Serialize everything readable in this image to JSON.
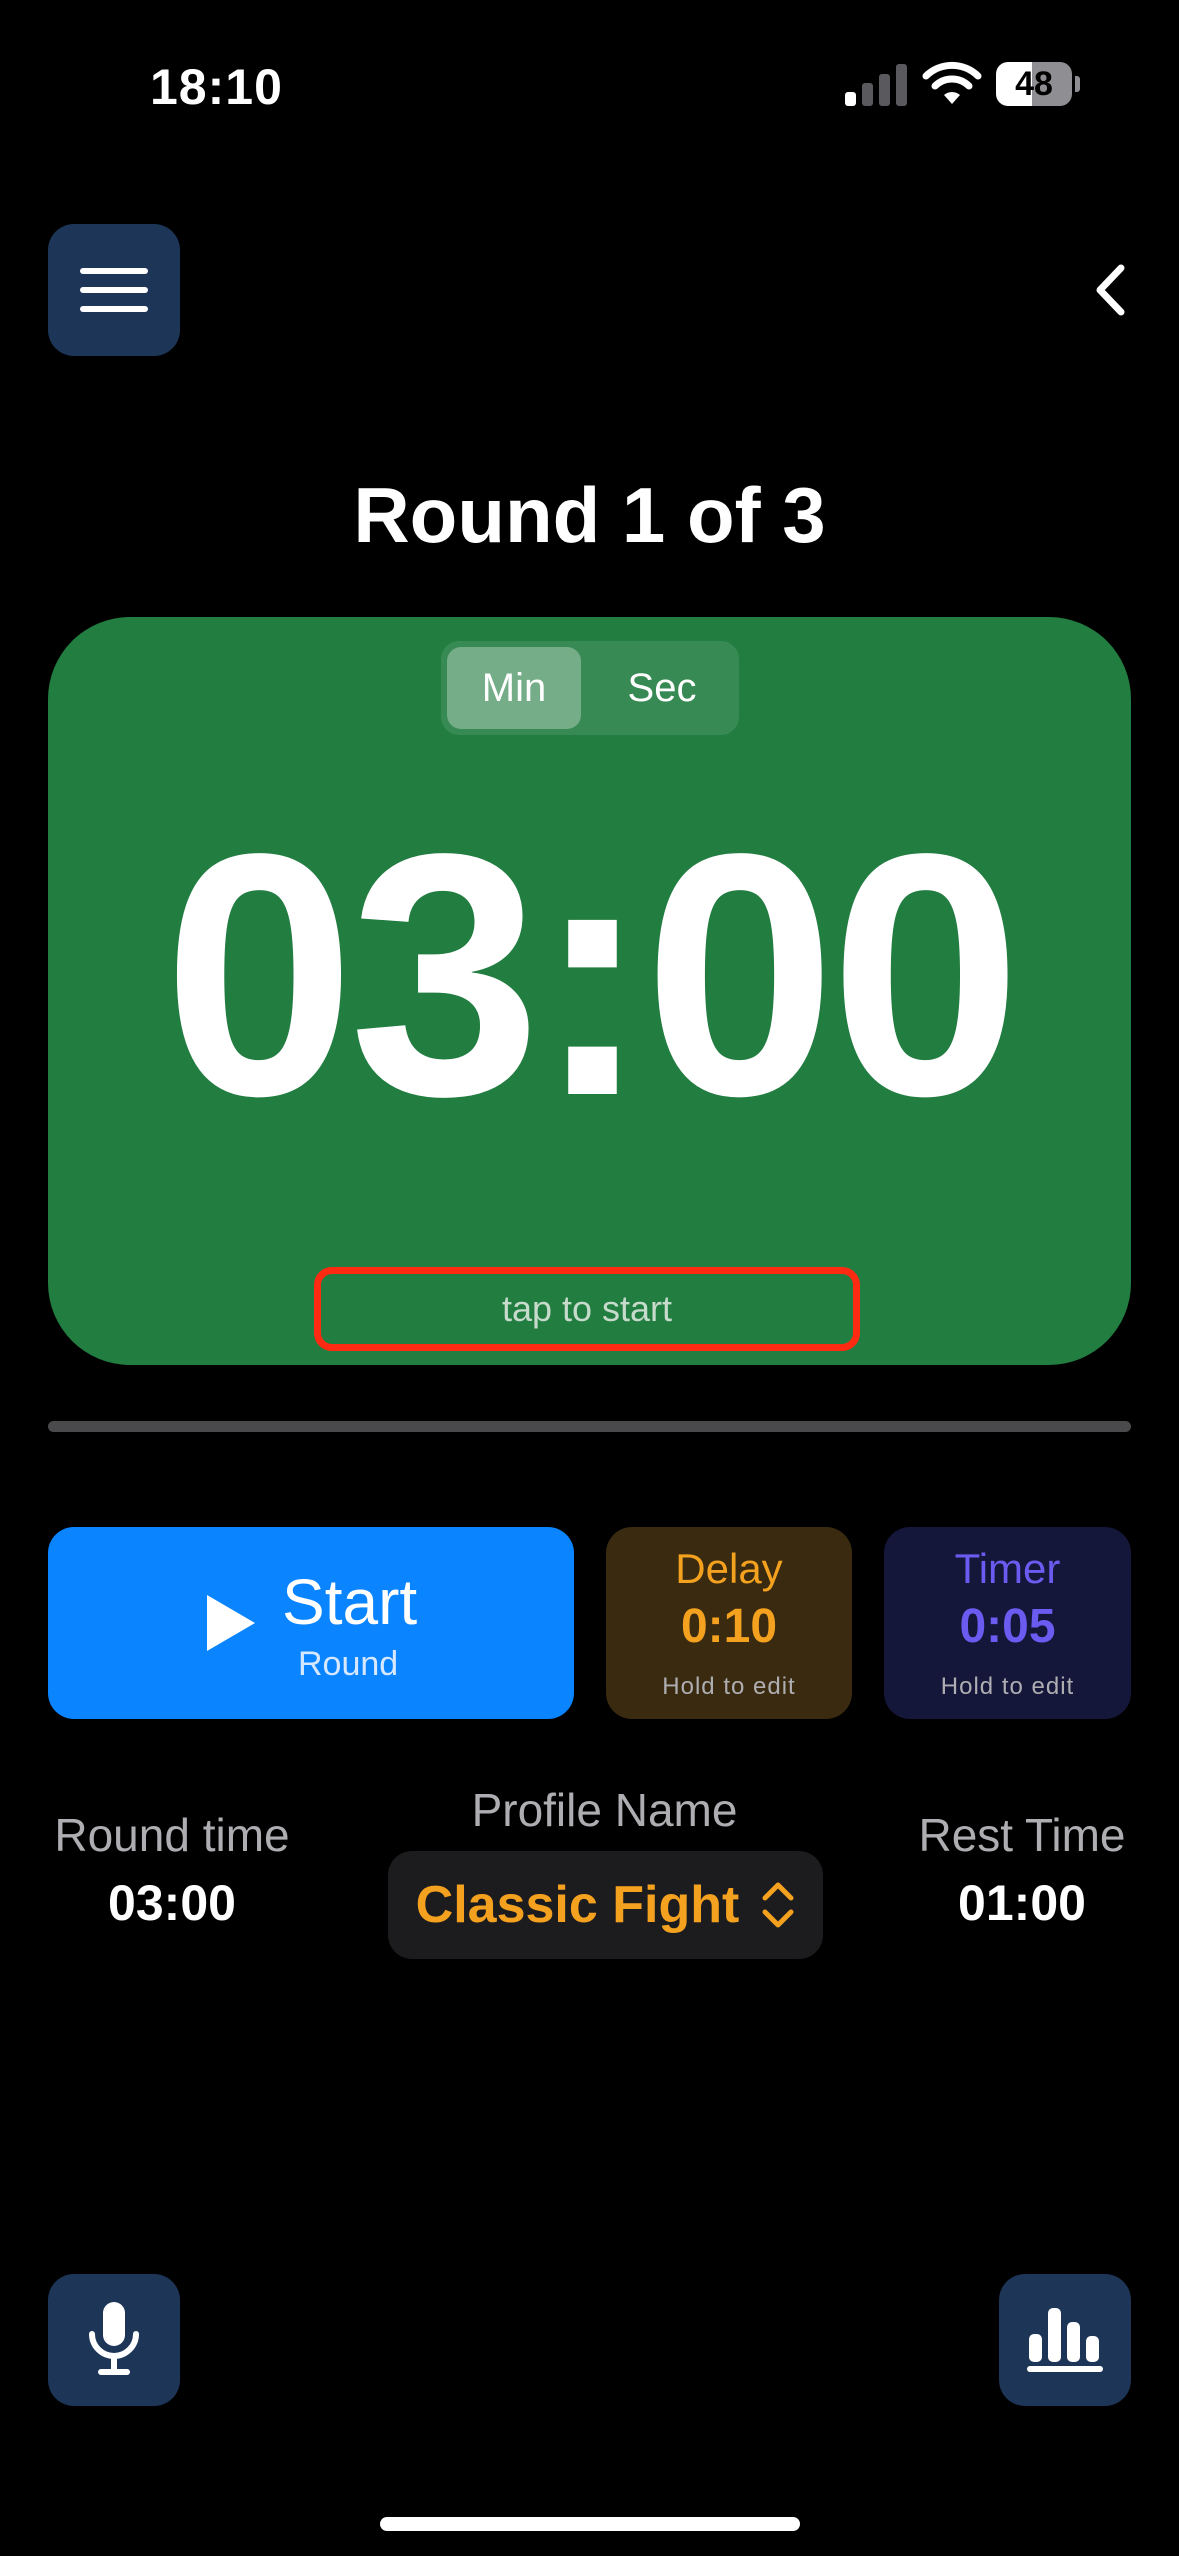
{
  "status_bar": {
    "time": "18:10",
    "battery_level": "48",
    "battery_fraction": 0.48
  },
  "header": {
    "menu_icon": "hamburger-icon",
    "back_icon": "chevron-left-icon",
    "round_title": "Round 1 of 3"
  },
  "timer": {
    "unit_options": [
      "Min",
      "Sec"
    ],
    "selected_unit": "Min",
    "display": "03:00",
    "hint": "tap to start",
    "background_color": "#227d41",
    "hint_highlight_color": "#ff2a12",
    "progress_fraction": 0
  },
  "actions": {
    "start": {
      "label": "Start",
      "sublabel": "Round",
      "icon": "play-icon",
      "color": "#0a84ff"
    },
    "delay": {
      "title": "Delay",
      "value": "0:10",
      "hint": "Hold to edit",
      "color": "#f4a11f"
    },
    "timer": {
      "title": "Timer",
      "value": "0:05",
      "hint": "Hold to edit",
      "color": "#6a5cf0"
    }
  },
  "info": {
    "round_time_label": "Round time",
    "round_time_value": "03:00",
    "profile_label": "Profile Name",
    "profile_value": "Classic Fight",
    "rest_time_label": "Rest Time",
    "rest_time_value": "01:00"
  },
  "bottom": {
    "mic_icon": "microphone-icon",
    "stats_icon": "bar-chart-icon"
  }
}
